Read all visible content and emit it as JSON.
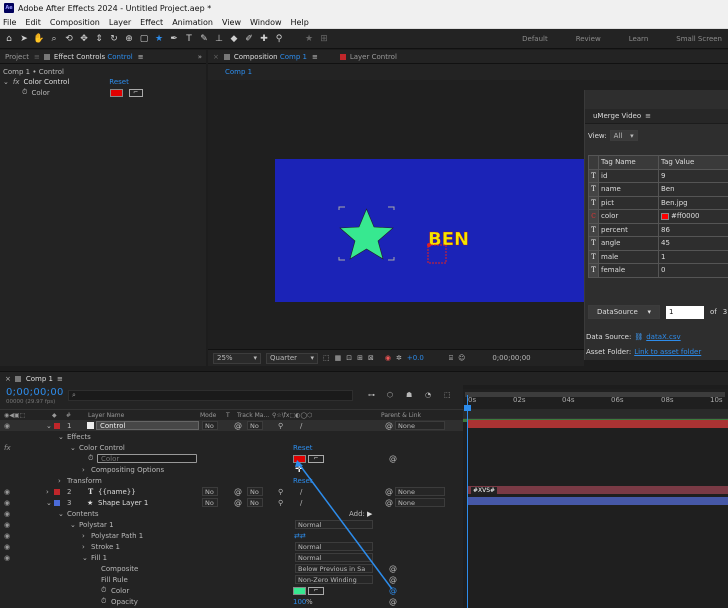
{
  "titlebar": {
    "logo": "Ae",
    "title": "Adobe After Effects 2024 - Untitled Project.aep *"
  },
  "menu": [
    "File",
    "Edit",
    "Composition",
    "Layer",
    "Effect",
    "Animation",
    "View",
    "Window",
    "Help"
  ],
  "workspaces": [
    "Default",
    "Review",
    "Learn",
    "Small Screen"
  ],
  "panels": {
    "project_tab": "Project",
    "effect_controls_tab": "Effect Controls",
    "effect_controls_layer": "Control",
    "composition_tab": "Composition",
    "composition_name": "Comp 1",
    "layer_tab": "Layer",
    "layer_name": "Control",
    "comp_crumb": "Comp 1"
  },
  "effect_controls": {
    "header": "Comp 1 • Control",
    "fx": "fx",
    "effect": "Color Control",
    "reset": "Reset",
    "color_label": "Color",
    "color_value": "#e00000"
  },
  "canvas": {
    "bg": "#1b23b7",
    "star_color": "#37e890",
    "text": "BEN",
    "text_color": "#f2e600"
  },
  "umerge": {
    "title": "uMerge Video",
    "view_label": "View:",
    "view_value": "All",
    "col_name": "Tag Name",
    "col_value": "Tag Value",
    "rows": [
      {
        "icon": "T",
        "name": "id",
        "value": "9"
      },
      {
        "icon": "T",
        "name": "name",
        "value": "Ben"
      },
      {
        "icon": "T",
        "name": "pict",
        "value": "Ben.jpg"
      },
      {
        "icon": "C",
        "name": "color",
        "value": "#ff0000"
      },
      {
        "icon": "T",
        "name": "percent",
        "value": "86"
      },
      {
        "icon": "T",
        "name": "angle",
        "value": "45"
      },
      {
        "icon": "T",
        "name": "male",
        "value": "1"
      },
      {
        "icon": "T",
        "name": "female",
        "value": "0"
      }
    ],
    "datasource_btn": "DataSource",
    "record": "1",
    "of": "of",
    "total": "3",
    "ds_label": "Data Source:",
    "ds_value": "dataX.csv",
    "af_label": "Asset Folder:",
    "af_value": "Link to asset folder"
  },
  "viewer": {
    "zoom": "25%",
    "resolution": "Quarter",
    "exposure": "+0.0",
    "timecode": "0;00;00;00"
  },
  "timeline": {
    "tab": "Comp 1",
    "timecode": "0;00;00;00",
    "frame_info": "00000 (29.97 fps)",
    "col_layer_name": "Layer Name",
    "col_mode": "Mode",
    "col_t": "T",
    "col_trackmat": "Track Ma...",
    "col_parent": "Parent & Link",
    "ruler": [
      "0s",
      "02s",
      "04s",
      "06s",
      "08s",
      "10s"
    ],
    "layers": [
      {
        "num": "1",
        "name": "Control",
        "mode": "No",
        "trkmat": "No",
        "parent": "None"
      },
      {
        "num": "2",
        "name": "{{name}}",
        "mode": "No",
        "trkmat": "No",
        "parent": "None"
      },
      {
        "num": "3",
        "name": "Shape Layer 1",
        "mode": "No",
        "trkmat": "No",
        "parent": "None"
      }
    ],
    "effects": "Effects",
    "color_control": "Color Control",
    "reset": "Reset",
    "color_prop": "Color",
    "color_placeholder": "Color",
    "compositing": "Compositing Options",
    "transform": "Transform",
    "transform_reset": "Reset",
    "contents": "Contents",
    "add": "Add:",
    "polystar": "Polystar 1",
    "polystar_mode": "Normal",
    "polystar_path": "Polystar Path 1",
    "stroke": "Stroke 1",
    "stroke_mode": "Normal",
    "fill": "Fill 1",
    "fill_mode": "Normal",
    "composite": "Composite",
    "composite_value": "Below Previous in Sa",
    "fill_rule": "Fill Rule",
    "fill_rule_value": "Non-Zero Winding",
    "fill_color": "Color",
    "opacity": "Opacity",
    "opacity_value": "100",
    "opacity_unit": "%",
    "expr_tag": "#XVS#"
  }
}
